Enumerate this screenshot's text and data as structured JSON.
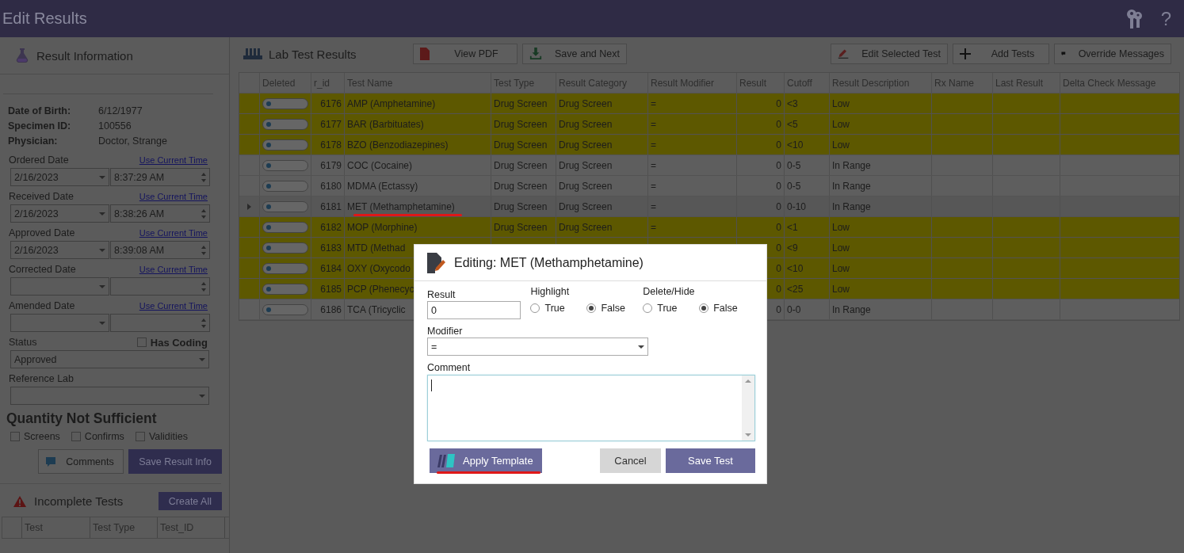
{
  "window": {
    "title": "Edit Results",
    "help_label": "?"
  },
  "result_info": {
    "title": "Result Information",
    "details": [
      {
        "label": "Date of Birth:",
        "value": "6/12/1977"
      },
      {
        "label": "Specimen ID:",
        "value": "100556"
      },
      {
        "label": "Physician:",
        "value": "Doctor, Strange"
      }
    ],
    "dates": [
      {
        "label": "Ordered Date",
        "link": "Use Current Time",
        "date": "2/16/2023",
        "time": "8:37:29 AM"
      },
      {
        "label": "Received Date",
        "link": "Use Current Time",
        "date": "2/16/2023",
        "time": "8:38:26 AM"
      },
      {
        "label": "Approved Date",
        "link": "Use Current Time",
        "date": "2/16/2023",
        "time": "8:39:08 AM"
      },
      {
        "label": "Corrected Date",
        "link": "Use Current Time"
      },
      {
        "label": "Amended Date",
        "link": "Use Current Time"
      }
    ],
    "status": {
      "label": "Status",
      "value": "Approved"
    },
    "has_coding": {
      "label": "Has Coding",
      "checked": false
    },
    "reference_lab": {
      "label": "Reference Lab"
    },
    "qns": {
      "title": "Quantity Not Sufficient",
      "options": [
        {
          "label": "Screens",
          "checked": false
        },
        {
          "label": "Confirms",
          "checked": false
        },
        {
          "label": "Validities",
          "checked": false
        }
      ]
    },
    "buttons": {
      "comments": "Comments",
      "save": "Save Result Info"
    }
  },
  "incomplete_tests": {
    "title": "Incomplete Tests",
    "create_all": "Create All",
    "columns": [
      "Test",
      "Test Type",
      "Test_ID"
    ]
  },
  "lab_results": {
    "title": "Lab Test Results",
    "toolbar": [
      {
        "label": "View PDF",
        "kind": "pdf"
      },
      {
        "label": "Save and Next",
        "kind": "download"
      },
      {
        "label": "Edit Selected Test",
        "kind": "edit"
      },
      {
        "label": "Add Tests",
        "kind": "add"
      },
      {
        "label": "Override Messages",
        "kind": "message"
      }
    ],
    "columns": [
      "Deleted",
      "r_id",
      "Test Name",
      "Test Type",
      "Result Category",
      "Result Modifier",
      "Result",
      "Cutoff",
      "Result Description",
      "Rx Name",
      "Last Result",
      "Delta Check Message"
    ],
    "rows": [
      {
        "deleted": false,
        "highlighted": true,
        "selected": false,
        "r_id": "6176",
        "test_name": "AMP (Amphetamine)",
        "test_type": "Drug Screen",
        "category": "Drug Screen",
        "modifier": "=",
        "result": "0",
        "cutoff": "<3",
        "description": "Low"
      },
      {
        "deleted": false,
        "highlighted": true,
        "selected": false,
        "r_id": "6177",
        "test_name": "BAR (Barbituates)",
        "test_type": "Drug Screen",
        "category": "Drug Screen",
        "modifier": "=",
        "result": "0",
        "cutoff": "<5",
        "description": "Low"
      },
      {
        "deleted": false,
        "highlighted": true,
        "selected": false,
        "r_id": "6178",
        "test_name": "BZO (Benzodiazepines)",
        "test_type": "Drug Screen",
        "category": "Drug Screen",
        "modifier": "=",
        "result": "0",
        "cutoff": "<10",
        "description": "Low"
      },
      {
        "deleted": false,
        "highlighted": false,
        "selected": false,
        "r_id": "6179",
        "test_name": "COC (Cocaine)",
        "test_type": "Drug Screen",
        "category": "Drug Screen",
        "modifier": "=",
        "result": "0",
        "cutoff": "0-5",
        "description": "In Range"
      },
      {
        "deleted": false,
        "highlighted": false,
        "selected": false,
        "r_id": "6180",
        "test_name": "MDMA (Ectassy)",
        "test_type": "Drug Screen",
        "category": "Drug Screen",
        "modifier": "=",
        "result": "0",
        "cutoff": "0-5",
        "description": "In Range"
      },
      {
        "deleted": false,
        "highlighted": false,
        "selected": true,
        "r_id": "6181",
        "test_name": "MET (Methamphetamine)",
        "test_type": "Drug Screen",
        "category": "Drug Screen",
        "modifier": "=",
        "result": "0",
        "cutoff": "0-10",
        "description": "In Range"
      },
      {
        "deleted": false,
        "highlighted": true,
        "selected": false,
        "r_id": "6182",
        "test_name": "MOP (Morphine)",
        "test_type": "Drug Screen",
        "category": "Drug Screen",
        "modifier": "=",
        "result": "0",
        "cutoff": "<1",
        "description": "Low"
      },
      {
        "deleted": false,
        "highlighted": true,
        "selected": false,
        "r_id": "6183",
        "test_name": "MTD (Methad",
        "result": "0",
        "cutoff": "<9",
        "description": "Low"
      },
      {
        "deleted": false,
        "highlighted": true,
        "selected": false,
        "r_id": "6184",
        "test_name": "OXY (Oxycodo",
        "result": "0",
        "cutoff": "<10",
        "description": "Low"
      },
      {
        "deleted": false,
        "highlighted": true,
        "selected": false,
        "r_id": "6185",
        "test_name": "PCP (Phenecyc",
        "result": "0",
        "cutoff": "<25",
        "description": "Low"
      },
      {
        "deleted": false,
        "highlighted": false,
        "selected": false,
        "r_id": "6186",
        "test_name": "TCA (Tricyclic",
        "result": "0",
        "cutoff": "0-0",
        "description": "In Range"
      }
    ]
  },
  "dialog": {
    "title": "Editing: MET (Methamphetamine)",
    "result": {
      "label": "Result",
      "value": "0"
    },
    "highlight": {
      "label": "Highlight",
      "options": [
        {
          "label": "True",
          "selected": false
        },
        {
          "label": "False",
          "selected": true
        }
      ]
    },
    "delete_hide": {
      "label": "Delete/Hide",
      "options": [
        {
          "label": "True",
          "selected": false
        },
        {
          "label": "False",
          "selected": true
        }
      ]
    },
    "modifier": {
      "label": "Modifier",
      "value": "="
    },
    "comment": {
      "label": "Comment"
    },
    "buttons": {
      "apply_template": "Apply Template",
      "cancel": "Cancel",
      "save": "Save Test"
    }
  }
}
